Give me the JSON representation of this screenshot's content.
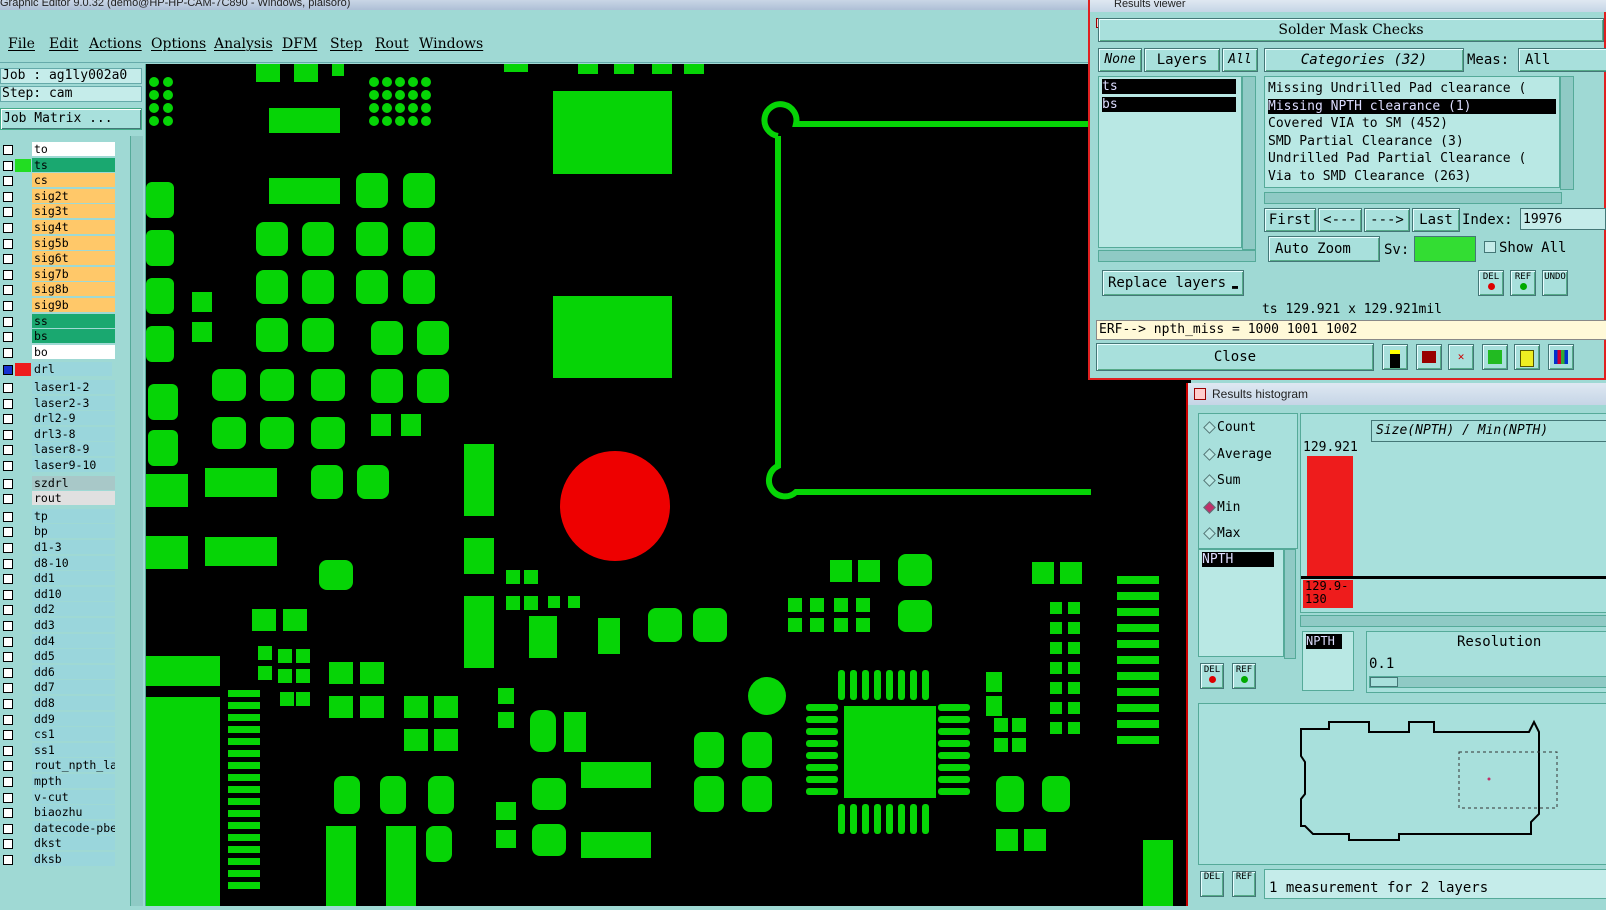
{
  "window": {
    "title": "Graphic Editor 9.0.32 (demo@HP-HP-CAM-7C890 - Windows, plalsoro)"
  },
  "menu": [
    {
      "label": "File"
    },
    {
      "label": "Edit"
    },
    {
      "label": "Actions"
    },
    {
      "label": "Options"
    },
    {
      "label": "Analysis"
    },
    {
      "label": "DFM"
    },
    {
      "label": "Step"
    },
    {
      "label": "Rout"
    },
    {
      "label": "Windows"
    }
  ],
  "job": {
    "job_text": "Job : ag1ly002a0",
    "step_text": "Step: cam",
    "matrix_button": "Job Matrix ..."
  },
  "layers": [
    {
      "name": "to",
      "color": "#ffffff"
    },
    {
      "name": "ts",
      "color": "#1aa870",
      "active": true
    },
    {
      "name": "cs",
      "color": "#ffc869"
    },
    {
      "name": "sig2t",
      "color": "#ffc869"
    },
    {
      "name": "sig3t",
      "color": "#ffc869"
    },
    {
      "name": "sig4t",
      "color": "#ffc869"
    },
    {
      "name": "sig5b",
      "color": "#ffc869"
    },
    {
      "name": "sig6t",
      "color": "#ffc869"
    },
    {
      "name": "sig7b",
      "color": "#ffc869"
    },
    {
      "name": "sig8b",
      "color": "#ffc869"
    },
    {
      "name": "sig9b",
      "color": "#ffc869"
    },
    {
      "name": "ss",
      "color": "#1aa870"
    },
    {
      "name": "bs",
      "color": "#1aa870"
    },
    {
      "name": "bo",
      "color": "#ffffff"
    },
    {
      "name": "drl",
      "color": "#9ad6dc"
    },
    {
      "name": "laser1-2",
      "color": "#9ad6dc"
    },
    {
      "name": "laser2-3",
      "color": "#9ad6dc"
    },
    {
      "name": "drl2-9",
      "color": "#9ad6dc"
    },
    {
      "name": "drl3-8",
      "color": "#9ad6dc"
    },
    {
      "name": "laser8-9",
      "color": "#9ad6dc"
    },
    {
      "name": "laser9-10",
      "color": "#9ad6dc"
    },
    {
      "name": "szdrl",
      "color": "#a8c8c8"
    },
    {
      "name": "rout",
      "color": "#e0e0e0"
    },
    {
      "name": "tp",
      "color": "#9ad6dc"
    },
    {
      "name": "bp",
      "color": "#9ad6dc"
    },
    {
      "name": "d1-3",
      "color": "#9ad6dc"
    },
    {
      "name": "d8-10",
      "color": "#9ad6dc"
    },
    {
      "name": "dd1",
      "color": "#9ad6dc"
    },
    {
      "name": "dd10",
      "color": "#9ad6dc"
    },
    {
      "name": "dd2",
      "color": "#9ad6dc"
    },
    {
      "name": "dd3",
      "color": "#9ad6dc"
    },
    {
      "name": "dd4",
      "color": "#9ad6dc"
    },
    {
      "name": "dd5",
      "color": "#9ad6dc"
    },
    {
      "name": "dd6",
      "color": "#9ad6dc"
    },
    {
      "name": "dd7",
      "color": "#9ad6dc"
    },
    {
      "name": "dd8",
      "color": "#9ad6dc"
    },
    {
      "name": "dd9",
      "color": "#9ad6dc"
    },
    {
      "name": "cs1",
      "color": "#9ad6dc"
    },
    {
      "name": "ss1",
      "color": "#9ad6dc"
    },
    {
      "name": "rout_npth_la",
      "color": "#9ad6dc"
    },
    {
      "name": "mpth",
      "color": "#9ad6dc"
    },
    {
      "name": "v-cut",
      "color": "#9ad6dc"
    },
    {
      "name": "biaozhu",
      "color": "#9ad6dc"
    },
    {
      "name": "datecode-pbe",
      "color": "#9ad6dc"
    },
    {
      "name": "dkst",
      "color": "#9ad6dc"
    },
    {
      "name": "dksb",
      "color": "#9ad6dc"
    }
  ],
  "results_viewer": {
    "title": "Results viewer",
    "heading": "Solder Mask Checks",
    "none_btn": "None",
    "layers_btn": "Layers",
    "all_btn": "All",
    "categories_btn": "Categories (32)",
    "meas_label": "Meas:",
    "meas_value": "All",
    "layer_list": [
      "ts",
      "bs"
    ],
    "categories": [
      "Missing Undrilled Pad clearance (",
      "Missing NPTH clearance (1)",
      "Covered VIA to SM (452)",
      "SMD Partial Clearance (3)",
      "Undrilled Pad Partial Clearance (",
      "Via to SMD Clearance (263)"
    ],
    "selected_category": 1,
    "nav": {
      "first": "First",
      "prev": "<---",
      "next": "--->",
      "last": "Last",
      "index_label": "Index:",
      "index_value": "19976"
    },
    "auto_zoom": "Auto Zoom",
    "sv_label": "Sv:",
    "show_all": "Show All",
    "replace_layers": "Replace layers",
    "del": "DEL",
    "ref": "REF",
    "undo": "UNDO",
    "measure": "ts 129.921 x 129.921mil",
    "erf": "ERF--> npth_miss = 1000 1001 1002",
    "close": "Close"
  },
  "histogram": {
    "title": "Results histogram",
    "modes": [
      "Count",
      "Average",
      "Sum",
      "Min",
      "Max"
    ],
    "selected_mode": "Min",
    "layer_item": "NPTH",
    "chart_title": "Size(NPTH) / Min(NPTH)",
    "bar_value_label": "129.921",
    "bar_axis_label_1": "129.9-",
    "bar_axis_label_2": "130",
    "bottom_layer": "NPTH",
    "resolution_label": "Resolution",
    "resolution_value": "0.1",
    "status": "1 measurement for 2 layers"
  }
}
